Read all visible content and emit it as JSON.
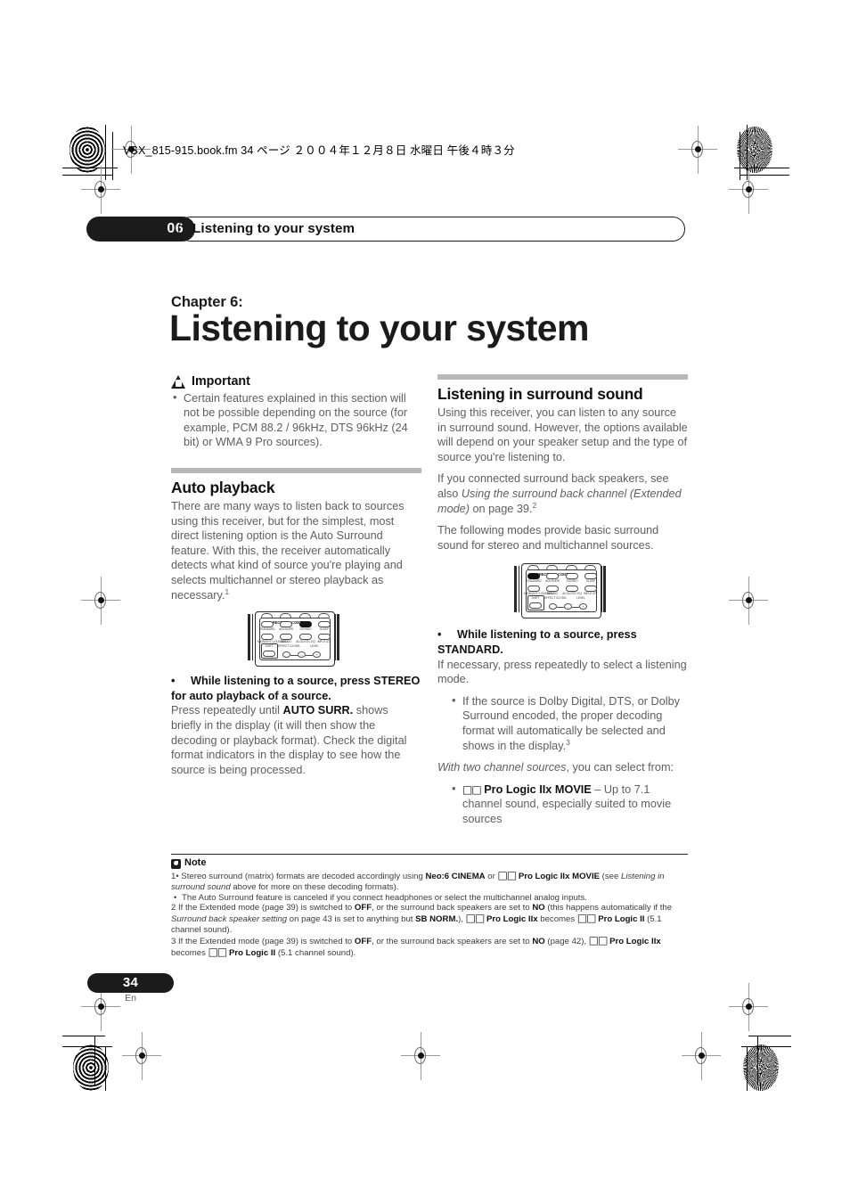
{
  "header": {
    "file_line": "VSX_815-915.book.fm  34 ページ  ２００４年１２月８日   水曜日   午後４時３分"
  },
  "running_head": {
    "chapter_number": "06",
    "title": "Listening to your system"
  },
  "chapter": {
    "kicker": "Chapter 6:",
    "title": "Listening to your system"
  },
  "left_column": {
    "important": {
      "icon": "warning-triangle-icon",
      "heading": "Important",
      "bullets": [
        "Certain features explained in this section will not be possible depending on the source (for example, PCM 88.2 / 96kHz, DTS 96kHz (24 bit) or WMA 9 Pro sources)."
      ]
    },
    "auto_playback": {
      "heading": "Auto playback",
      "body": "There are many ways to listen back to sources using this receiver, but for the simplest, most direct listening option is the Auto Surround feature. With this, the receiver automatically detects what kind of source you're playing and selects multichannel or stereo playback as necessary.",
      "body_footnote": "1",
      "instruction_bullet": "•",
      "instruction": "While listening to a source, press STEREO for auto playback of a source.",
      "follow_1": "Press repeatedly until ",
      "follow_1_bold": "AUTO SURR.",
      "follow_2": " shows briefly in the display (it will then show the decoding or playback format). Check the digital format indicators in the display to see how the source is being processed."
    }
  },
  "right_column": {
    "surround": {
      "heading": "Listening in surround sound",
      "para1": "Using this receiver, you can listen to any source in surround sound. However, the options available will depend on your speaker setup and the type of source you're listening to.",
      "para2_a": "If you connected surround back speakers, see also ",
      "para2_italic": "Using the surround back channel (Extended mode)",
      "para2_b": " on page 39.",
      "para2_footnote": "2",
      "para3": "The following modes provide basic surround sound for stereo and multichannel sources.",
      "instruction_bullet": "•",
      "instruction": "While listening to a source, press STANDARD.",
      "follow": "If necessary, press repeatedly to select a listening mode.",
      "sub_bullet_a": "If the source is Dolby Digital, DTS, or Dolby Surround encoded, the proper decoding format will automatically be selected and shows in the display.",
      "sub_bullet_a_footnote": "3",
      "two_channel_italic": "With two channel sources",
      "two_channel_rest": ", you can select from:",
      "option_mark": "□□",
      "option_bold": "Pro Logic IIx MOVIE",
      "option_rest": " – Up to 7.1 channel sound, especially suited to movie sources"
    }
  },
  "remote_left": {
    "name": "receiver-control-remote-stereo",
    "panel_label": "RECEIVER CONTROL",
    "buttons": [
      {
        "label": "STANDARD",
        "active": false
      },
      {
        "label": "ADV.SURR",
        "active": false
      },
      {
        "label": "STEREO",
        "active": true
      },
      {
        "label": "SLEEP",
        "active": false
      },
      {
        "label": "MIDNIGHT/ LOUDNESS",
        "active": false
      },
      {
        "label": "DIALOG",
        "active": false
      },
      {
        "label": "ACOUSTIC EQ",
        "active": false
      },
      {
        "label": "INPUT ATT",
        "active": false
      },
      {
        "label": "SHIFT",
        "active": false
      },
      {
        "label": "EFFECT /CH SEL",
        "active": false
      },
      {
        "label": "LEVEL",
        "active": false
      }
    ],
    "level_minus": "–",
    "level_plus": "+"
  },
  "remote_right": {
    "name": "receiver-control-remote-standard",
    "panel_label": "RECEIVER CONTROL",
    "buttons": [
      {
        "label": "STANDARD",
        "active": true
      },
      {
        "label": "ADV.SURR",
        "active": false
      },
      {
        "label": "STEREO",
        "active": false
      },
      {
        "label": "SLEEP",
        "active": false
      },
      {
        "label": "MIDNIGHT/ LOUDNESS",
        "active": false
      },
      {
        "label": "DIALOG",
        "active": false
      },
      {
        "label": "ACOUSTIC EQ",
        "active": false
      },
      {
        "label": "INPUT ATT",
        "active": false
      },
      {
        "label": "SHIFT",
        "active": false
      },
      {
        "label": "EFFECT /CH SEL",
        "active": false
      },
      {
        "label": "LEVEL",
        "active": false
      }
    ],
    "level_minus": "–",
    "level_plus": "+"
  },
  "note": {
    "icon": "note-icon",
    "heading": "Note",
    "items": [
      {
        "num": "1",
        "text_a": "• Stereo surround (matrix) formats are decoded accordingly using ",
        "bold_a": "Neo:6 CINEMA",
        "text_b": " or ",
        "mark": "□□",
        "bold_b": " Pro Logic IIx MOVIE",
        "text_c": " (see ",
        "italic": "Listening in surround sound",
        "text_d": " above for more on these decoding formats)."
      },
      {
        "num": "",
        "sub": true,
        "text": "The Auto Surround feature is canceled if you connect headphones or select the multichannel analog inputs."
      },
      {
        "num": "2",
        "text_a": " If the Extended mode (page 39) is switched to ",
        "bold_a": "OFF",
        "text_b": ", or the surround back speakers are set to ",
        "bold_b": "NO",
        "text_c": " (this happens automatically if the ",
        "italic": "Surround back speaker setting",
        "text_d": " on page 43 is set to anything but ",
        "bold_c": "SB NORM.",
        "text_e": "), ",
        "mark1": "□□",
        "bold_d": " Pro Logic IIx",
        "text_f": " becomes ",
        "mark2": "□□",
        "bold_e": " Pro Logic II",
        "text_g": " (5.1 channel sound)."
      },
      {
        "num": "3",
        "text_a": " If the Extended mode (page 39) is switched to ",
        "bold_a": "OFF",
        "text_b": ", or the surround back speakers are set to ",
        "bold_b": "NO",
        "text_c": " (page 42), ",
        "mark1": "□□",
        "bold_c": " Pro Logic IIx",
        "text_d": " becomes ",
        "mark2": "□□",
        "bold_d": " Pro Logic II",
        "text_e": " (5.1 channel sound)."
      }
    ]
  },
  "footer": {
    "page_number": "34",
    "language": "En"
  },
  "colors": {
    "ink": "#1b1b1b",
    "body_text": "#5e5e5e",
    "rule": "#b8b8b8"
  }
}
